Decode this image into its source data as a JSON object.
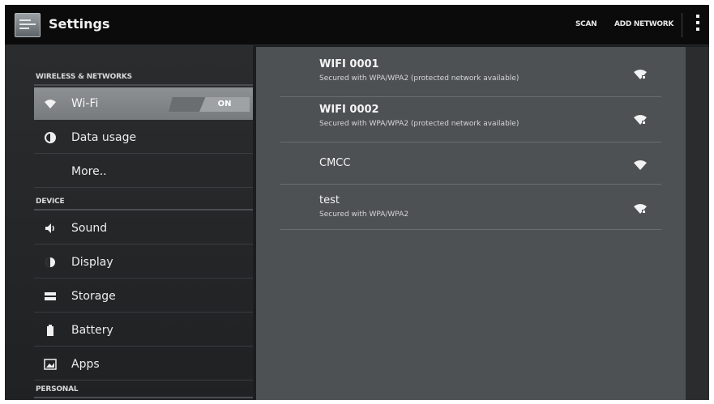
{
  "actionbar": {
    "title": "Settings",
    "actions": {
      "scan": "SCAN",
      "add_network": "ADD NETWORK"
    }
  },
  "sidebar": {
    "sections": [
      {
        "header": "WIRELESS & NETWORKS"
      },
      {
        "header": "DEVICE"
      },
      {
        "header": "PERSONAL"
      }
    ],
    "items": [
      {
        "label": "Wi-Fi",
        "icon": "wifi-icon",
        "selected": true,
        "toggle": "ON"
      },
      {
        "label": "Data usage",
        "icon": "data-usage-icon"
      },
      {
        "label": "More..",
        "icon": ""
      },
      {
        "label": "Sound",
        "icon": "sound-icon"
      },
      {
        "label": "Display",
        "icon": "display-icon"
      },
      {
        "label": "Storage",
        "icon": "storage-icon"
      },
      {
        "label": "Battery",
        "icon": "battery-icon"
      },
      {
        "label": "Apps",
        "icon": "apps-icon"
      }
    ]
  },
  "networks": [
    {
      "ssid": "WIFI 0001",
      "security": "Secured with WPA/WPA2 (protected network available)",
      "locked": true
    },
    {
      "ssid": "WIFI 0002",
      "security": "Secured with WPA/WPA2 (protected network available)",
      "locked": true
    },
    {
      "ssid": "CMCC",
      "security": "",
      "locked": false
    },
    {
      "ssid": "test",
      "security": "Secured with WPA/WPA2",
      "locked": true
    }
  ],
  "colors": {
    "actionbar": "#0b0b0c",
    "sidebar_bg": "#2a2c2e",
    "selected_item": "#8d9194",
    "details_bg": "#4d5154"
  }
}
